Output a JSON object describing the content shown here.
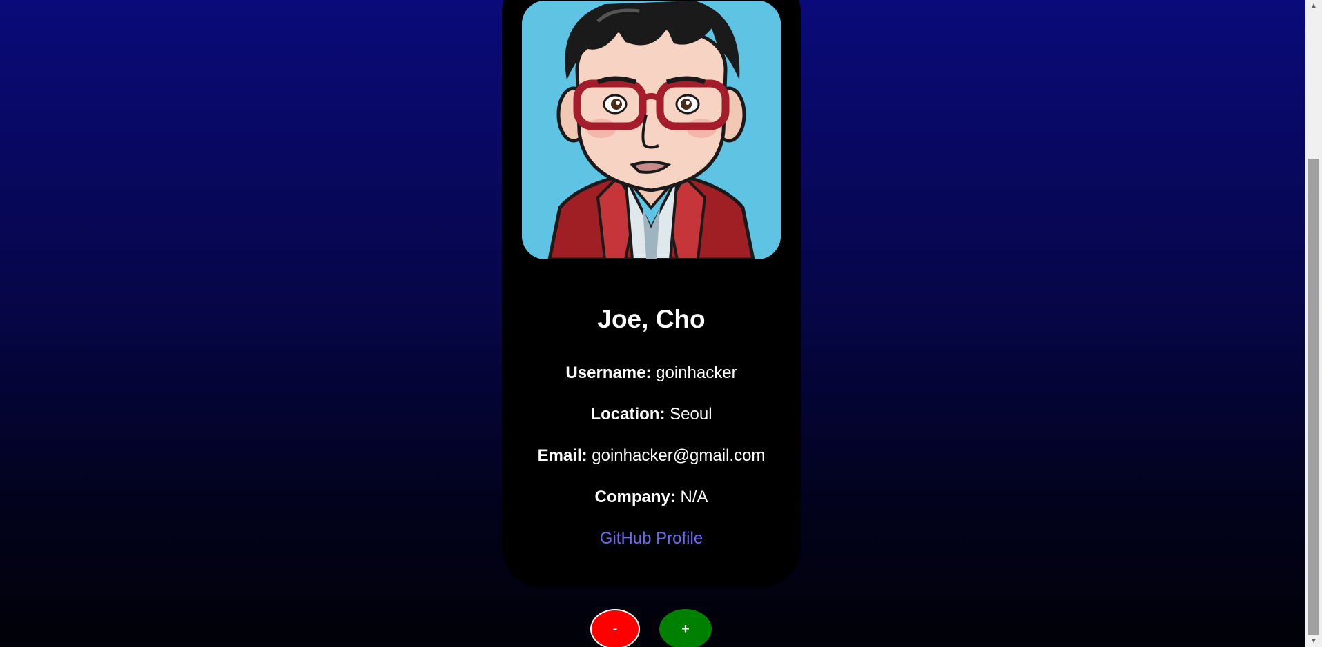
{
  "profile": {
    "name": "Joe, Cho",
    "username_label": "Username:",
    "username": "goinhacker",
    "location_label": "Location:",
    "location": "Seoul",
    "email_label": "Email:",
    "email": "goinhacker@gmail.com",
    "company_label": "Company:",
    "company": "N/A",
    "github_link": "GitHub Profile",
    "avatar_icon": "cartoon-avatar-glasses"
  },
  "controls": {
    "minus_label": "-",
    "plus_label": "+"
  },
  "scrollbar": {
    "up_glyph": "▲",
    "down_glyph": "▼"
  },
  "colors": {
    "card": "#000000",
    "link": "#6a6af0",
    "minus_button": "#ff0000",
    "plus_button": "#008000"
  }
}
